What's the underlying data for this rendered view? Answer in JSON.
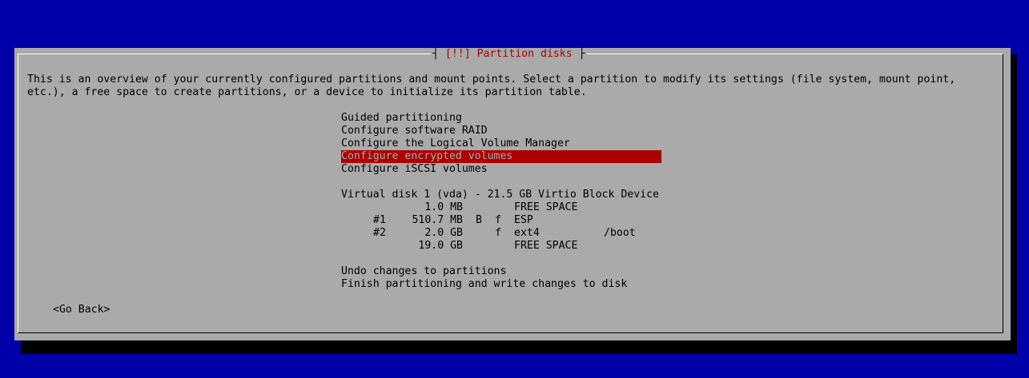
{
  "dialog": {
    "title": "[!!] Partition disks",
    "description_lines": [
      "This is an overview of your currently configured partitions and mount points. Select a partition to modify its settings (file system, mount point,",
      "etc.), a free space to create partitions, or a device to initialize its partition table."
    ],
    "menu_items": [
      "Guided partitioning",
      "Configure software RAID",
      "Configure the Logical Volume Manager",
      "Configure encrypted volumes",
      "Configure iSCSI volumes"
    ],
    "selected_item": "Configure encrypted volumes",
    "disk": {
      "label": "Virtual disk 1 (vda) - 21.5 GB Virtio Block Device",
      "partitions": [
        {
          "num": "",
          "size": "1.0 MB",
          "boot": "",
          "format": "",
          "fs": "FREE SPACE",
          "mount": ""
        },
        {
          "num": "#1",
          "size": "510.7 MB",
          "boot": "B",
          "format": "f",
          "fs": "ESP",
          "mount": ""
        },
        {
          "num": "#2",
          "size": "2.0 GB",
          "boot": "",
          "format": "f",
          "fs": "ext4",
          "mount": "/boot"
        },
        {
          "num": "",
          "size": "19.0 GB",
          "boot": "",
          "format": "",
          "fs": "FREE SPACE",
          "mount": ""
        }
      ]
    },
    "actions": [
      "Undo changes to partitions",
      "Finish partitioning and write changes to disk"
    ],
    "go_back_label": "<Go Back>"
  },
  "colors": {
    "background": "#0000a8",
    "dialog": "#aaaaaa",
    "highlight": "#aa0000",
    "title_text": "#aa0000"
  }
}
